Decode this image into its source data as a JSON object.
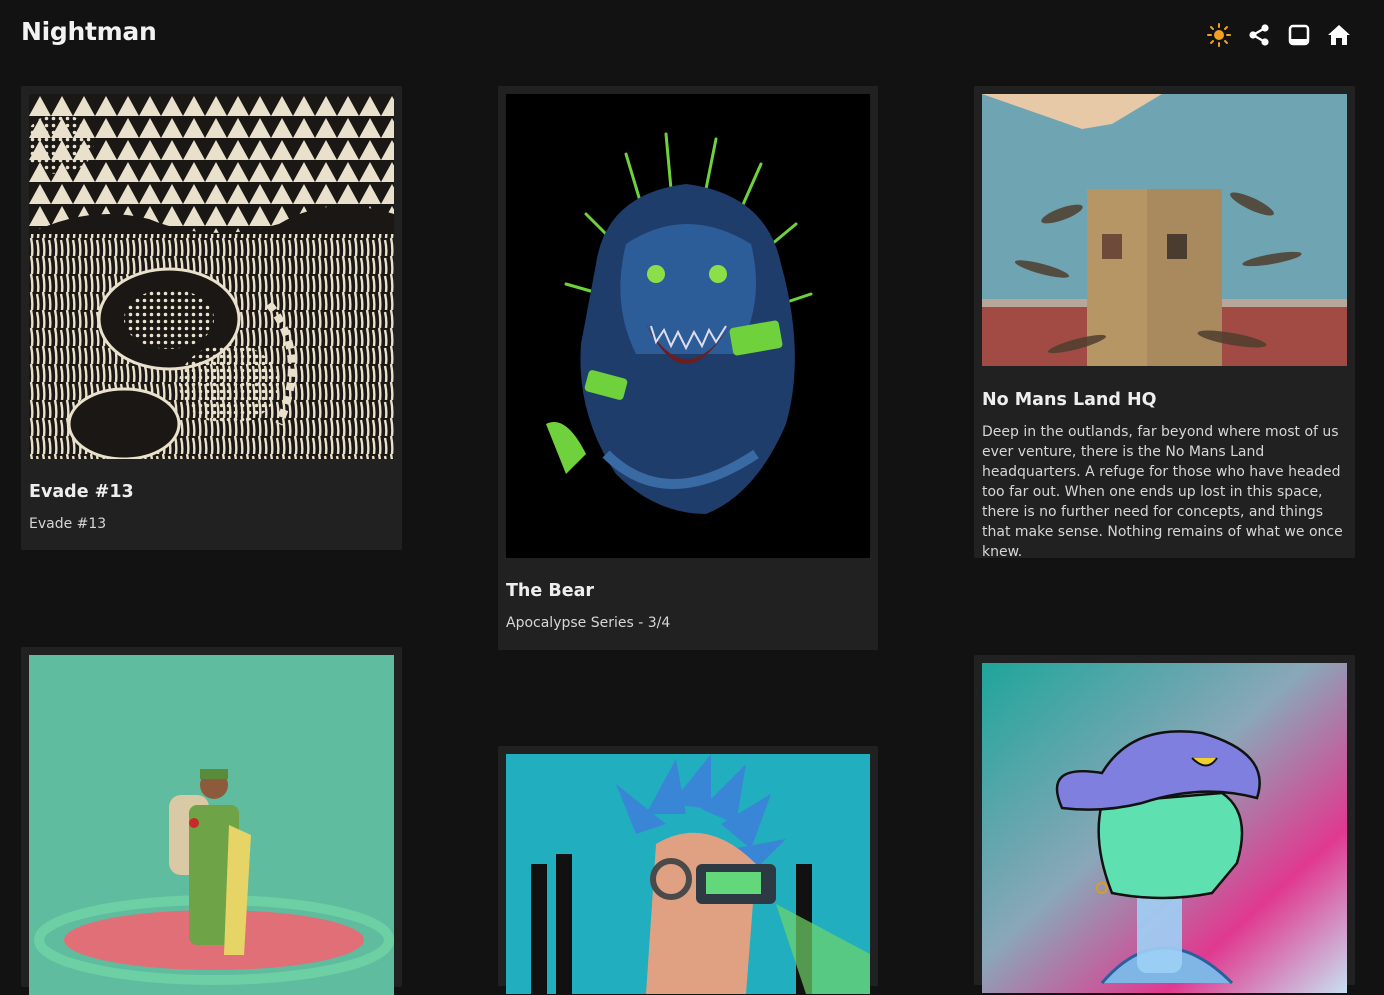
{
  "app": {
    "title": "Nightman"
  },
  "toolbar": {
    "icons": [
      "sun-icon",
      "share-icon",
      "window-icon",
      "home-icon"
    ],
    "accent": "#f0a020"
  },
  "gallery": {
    "cards": [
      {
        "title": "Evade #13",
        "description": "Evade #13",
        "art": "black-white-pattern-artwork"
      },
      {
        "title": "The Bear",
        "description": "Apocalypse Series - 3/4",
        "art": "blue-bear-artwork"
      },
      {
        "title": "No Mans Land HQ",
        "description": "Deep in the outlands, far beyond where most of us ever venture, there is the No Mans Land headquarters. A refuge for those who have headed too far out. When one ends up lost in this space, there is no further need for concepts, and things that make sense. Nothing remains of what we once knew.",
        "art": "tower-landscape-artwork"
      },
      {
        "title": "",
        "description": "",
        "art": "soldier-on-teal-artwork"
      },
      {
        "title": "",
        "description": "",
        "art": "cyberpunk-mohawk-artwork"
      },
      {
        "title": "",
        "description": "",
        "art": "skeleton-cowboy-artwork"
      }
    ]
  }
}
